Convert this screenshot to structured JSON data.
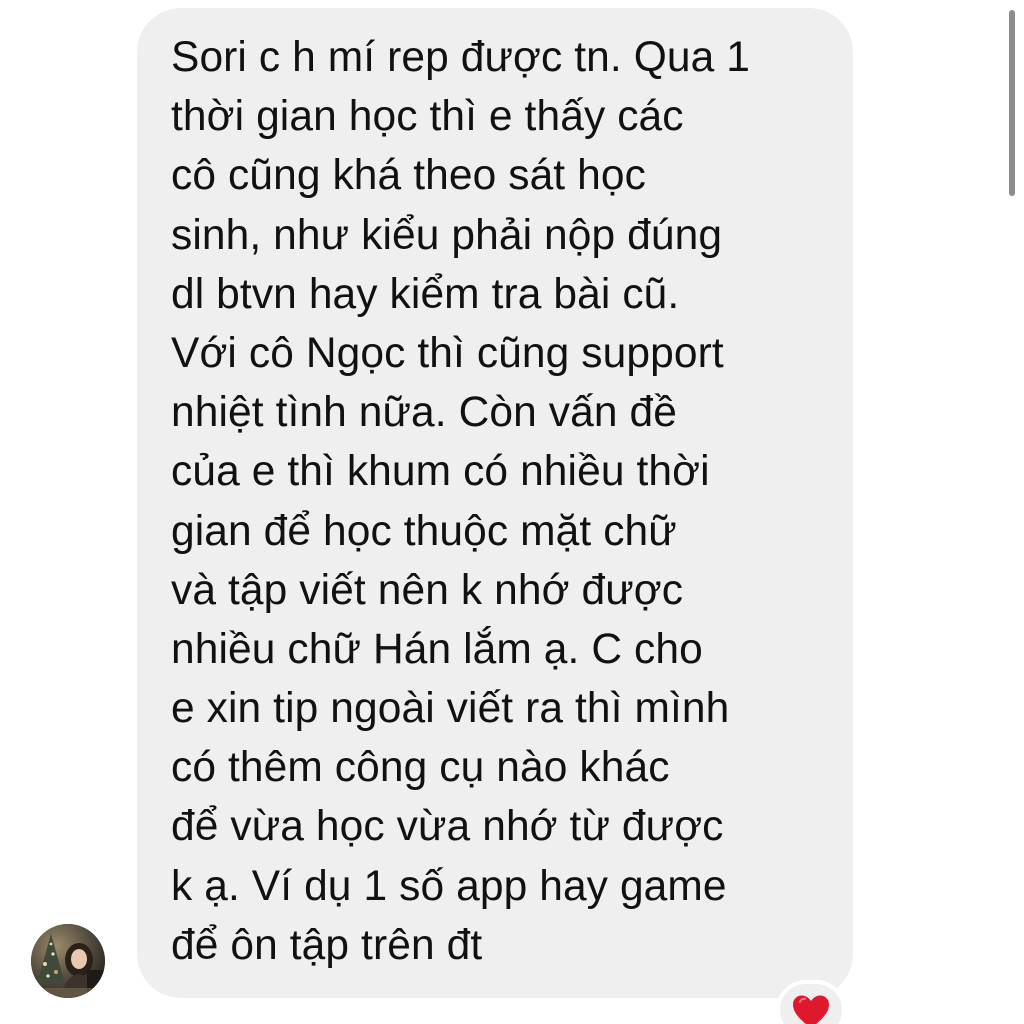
{
  "message": {
    "lines": [
      "Sori c h mí rep được tn. Qua 1",
      "thời gian học thì e thấy các",
      "cô cũng khá theo sát học",
      "sinh, như kiểu phải nộp đúng",
      "dl btvn hay kiểm tra bài cũ.",
      "Với cô Ngọc thì cũng support",
      "nhiệt tình nữa. Còn vấn đề",
      "của e thì khum có nhiều thời",
      "gian để học thuộc mặt chữ",
      "và tập viết nên k nhớ được",
      "nhiều chữ Hán lắm ạ.  C cho",
      "e xin tip ngoài viết ra thì mình",
      "có thêm công cụ nào khác",
      "để vừa học vừa nhớ từ được",
      "k ạ. Ví dụ 1 số app hay game",
      "để ôn tập trên đt"
    ]
  },
  "reaction": {
    "icon": "red-heart-icon",
    "color": "#e0182d"
  },
  "colors": {
    "bubble": "#efefef",
    "text": "#111111",
    "background": "#ffffff",
    "scrollbar": "#8d8d8d"
  },
  "avatar": {
    "icon": "sender-avatar-photo"
  }
}
